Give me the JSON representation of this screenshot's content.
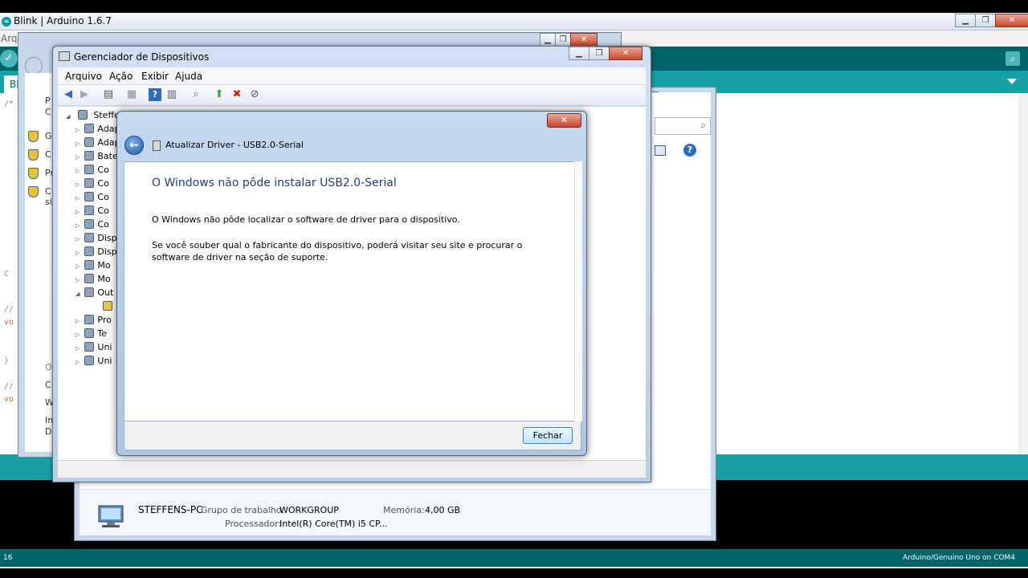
{
  "arduino": {
    "title": "Blink | Arduino 1.6.7",
    "menu_fragment": "Arq",
    "tab": "Blink",
    "code_fragments": [
      "/*",
      "C",
      "//",
      "vo",
      "}",
      "//",
      "vo"
    ],
    "footer_line": "16",
    "footer_board": "Arduino/Genuino Uno on COM4"
  },
  "control_panel": {
    "items": [
      "G",
      "C",
      "Pr",
      "C",
      "si"
    ],
    "left_labels": [
      "P",
      "C",
      "O",
      "C",
      "W",
      "In",
      "D"
    ]
  },
  "system_window": {
    "computer_name": "STEFFENS-PC",
    "workgroup_label": "Grupo de trabalho:",
    "workgroup_value": "WORKGROUP",
    "memory_label": "Memória:",
    "memory_value": "4,00 GB",
    "processor_label": "Processador:",
    "processor_value": "Intel(R) Core(TM) i5 CP..."
  },
  "device_manager": {
    "title": "Gerenciador de Dispositivos",
    "menu": [
      "Arquivo",
      "Ação",
      "Exibir",
      "Ajuda"
    ],
    "tree": {
      "root": "Steffens-PC",
      "items": [
        {
          "label": "Adaptadores de rede",
          "exp": "▷"
        },
        {
          "label": "Adaptadores de vídeo",
          "exp": "▷"
        },
        {
          "label": "Baterias",
          "exp": "▷"
        },
        {
          "label": "Co",
          "exp": "▷"
        },
        {
          "label": "Co",
          "exp": "▷"
        },
        {
          "label": "Co",
          "exp": "▷"
        },
        {
          "label": "Co",
          "exp": "▷"
        },
        {
          "label": "Co",
          "exp": "▷"
        },
        {
          "label": "Disp",
          "exp": "▷"
        },
        {
          "label": "Disp",
          "exp": "▷"
        },
        {
          "label": "Mo",
          "exp": "▷"
        },
        {
          "label": "Mo",
          "exp": "▷"
        },
        {
          "label": "Out",
          "exp": "◢"
        },
        {
          "label": "",
          "exp": ""
        },
        {
          "label": "Pro",
          "exp": "▷"
        },
        {
          "label": "Te",
          "exp": "▷"
        },
        {
          "label": "Uni",
          "exp": "▷"
        },
        {
          "label": "Uni",
          "exp": "▷"
        }
      ]
    }
  },
  "dialog": {
    "header": "Atualizar Driver -  USB2.0-Serial",
    "heading": "O Windows não pôde instalar USB2.0-Serial",
    "paragraph1": "O Windows não pôde localizar o software de driver para o dispositivo.",
    "paragraph2": "Se você souber qual o fabricante do dispositivo, poderá visitar seu site e procurar o software de driver na seção de suporte.",
    "close_button": "Fechar",
    "close_x": "✕"
  }
}
